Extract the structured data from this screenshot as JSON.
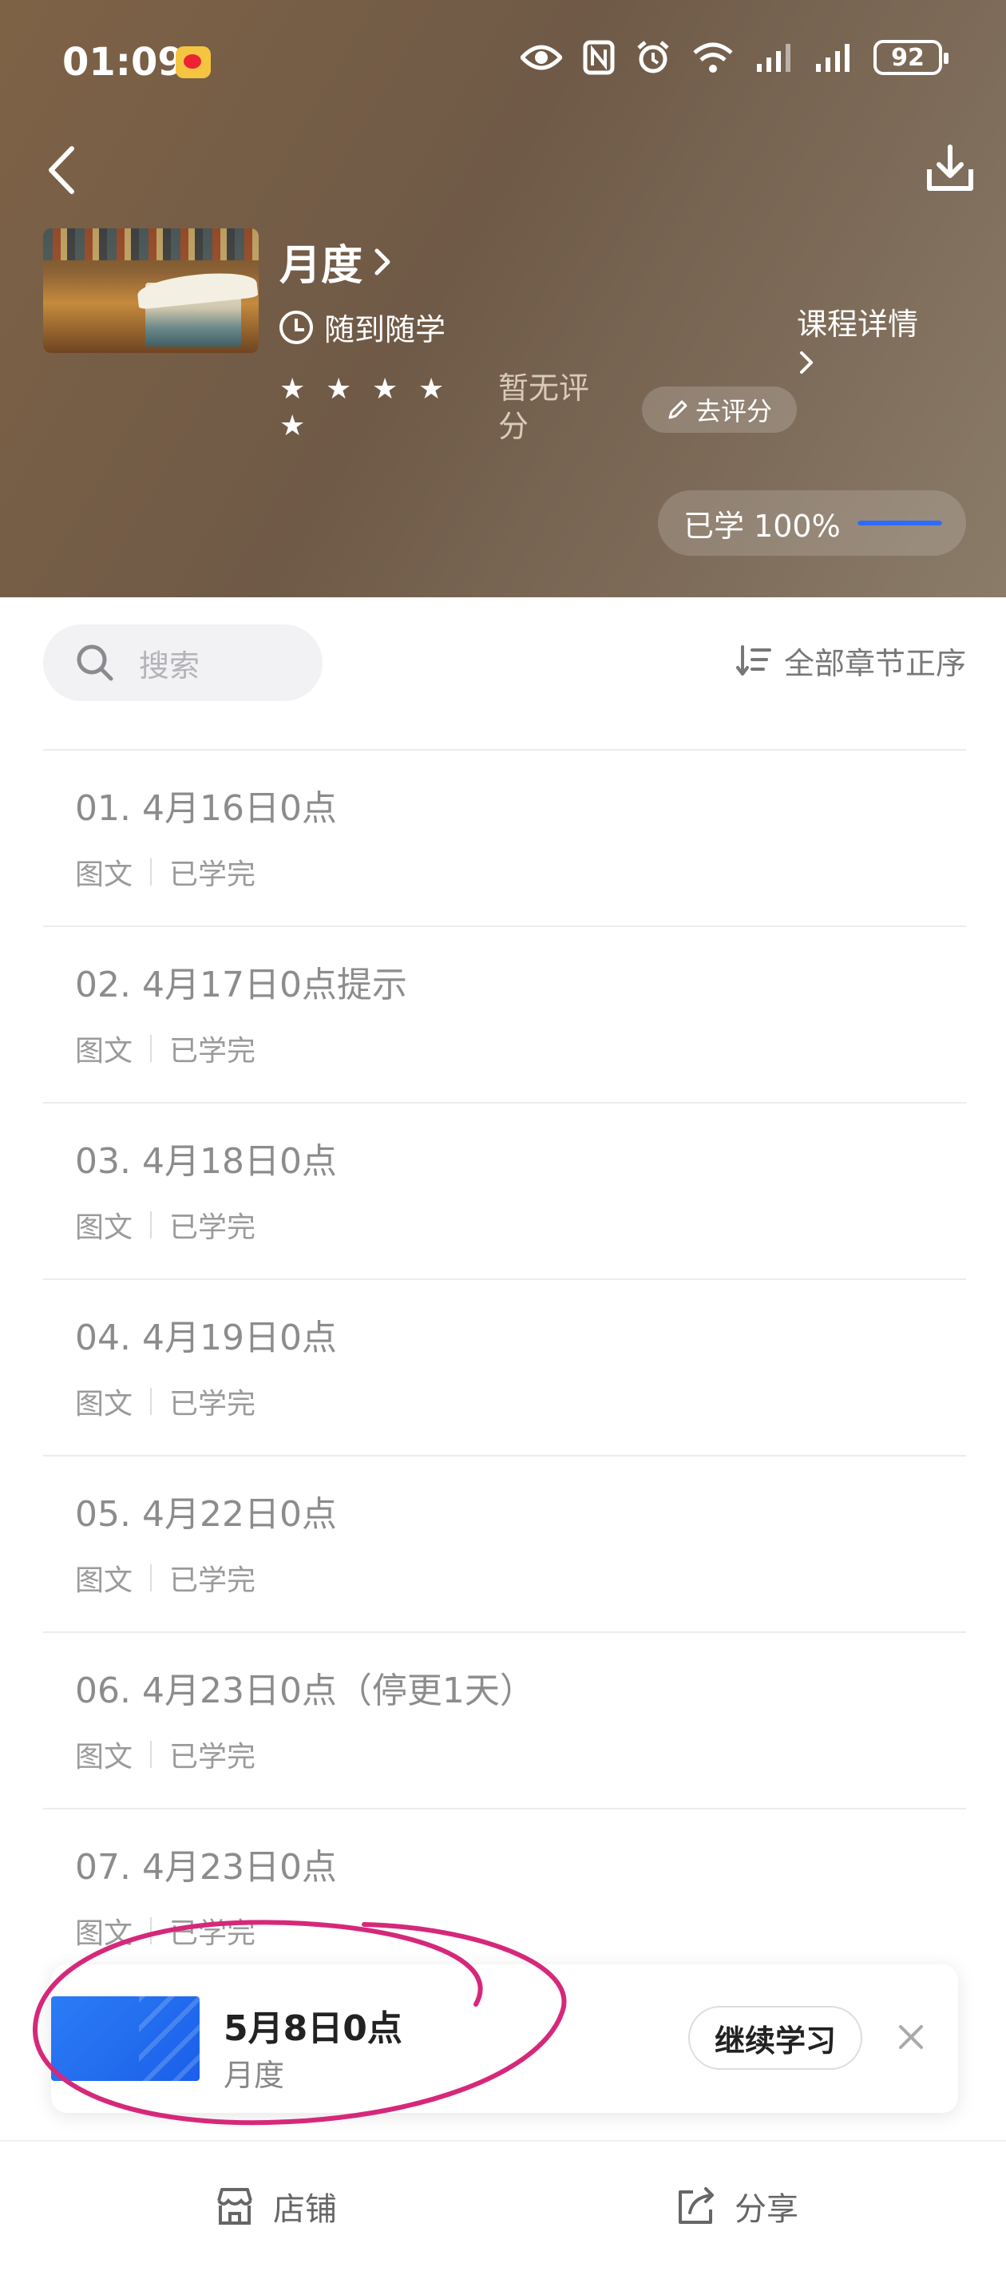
{
  "status_bar": {
    "time": "01:09",
    "battery": "92"
  },
  "header": {
    "course_title": "月度",
    "study_mode": "随到随学",
    "rating_text": "暂无评分",
    "rate_button": "去评分",
    "detail_link": "课程详情",
    "progress_label": "已学 100%",
    "progress_value": 1.0,
    "star_count": 5
  },
  "toolbar": {
    "search_placeholder": "搜索",
    "sort_label": "全部章节正序"
  },
  "chapters": [
    {
      "title": "01. 4月16日0点",
      "type": "图文",
      "status": "已学完"
    },
    {
      "title": "02. 4月17日0点提示",
      "type": "图文",
      "status": "已学完"
    },
    {
      "title": "03. 4月18日0点",
      "type": "图文",
      "status": "已学完"
    },
    {
      "title": "04. 4月19日0点",
      "type": "图文",
      "status": "已学完"
    },
    {
      "title": "05. 4月22日0点",
      "type": "图文",
      "status": "已学完"
    },
    {
      "title": "06. 4月23日0点（停更1天）",
      "type": "图文",
      "status": "已学完"
    },
    {
      "title": "07. 4月23日0点",
      "type": "图文",
      "status": "已学完"
    }
  ],
  "continue_card": {
    "title": "5月8日0点",
    "subtitle": "月度",
    "button": "继续学习"
  },
  "bottom_bar": {
    "shop": "店铺",
    "share": "分享"
  },
  "colors": {
    "accent": "#2f6bff",
    "annotation": "#d6287a"
  }
}
